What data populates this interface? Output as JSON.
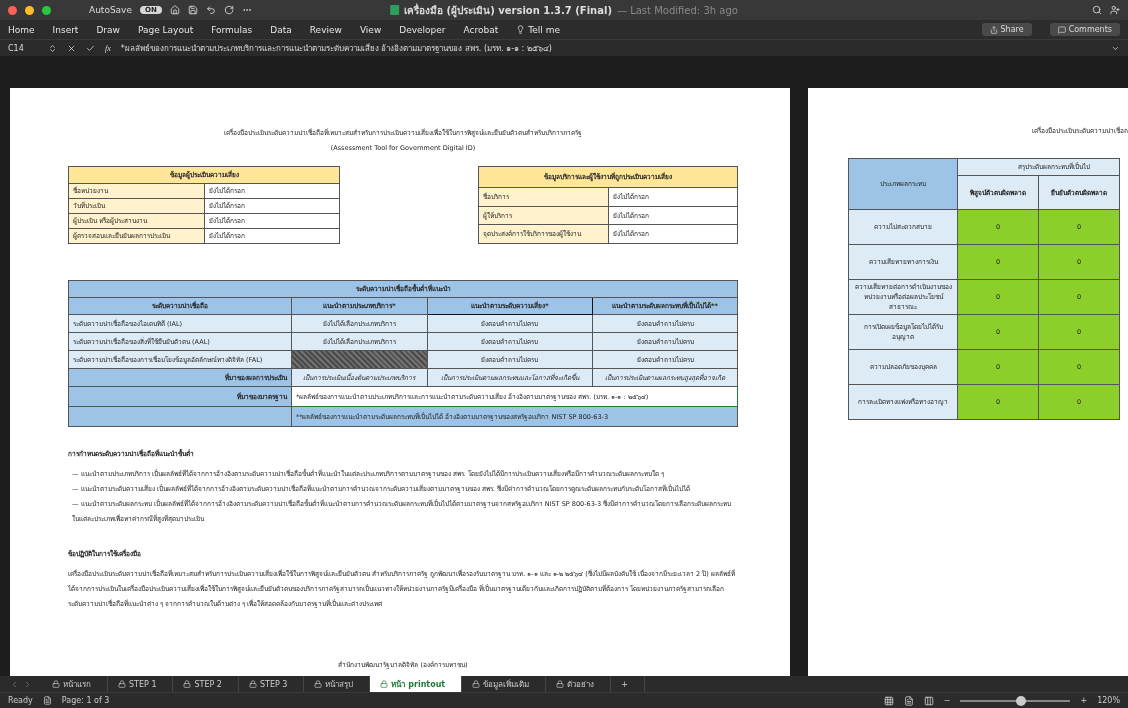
{
  "window": {
    "title": "เครื่องมือ (ผู้ประเมิน) version 1.3.7 (Final)",
    "modified": "— Last Modified: 3h ago",
    "autosave": {
      "label": "AutoSave",
      "state": "ON",
      "on": true
    }
  },
  "ribbon": {
    "tabs": [
      "Home",
      "Insert",
      "Draw",
      "Page Layout",
      "Formulas",
      "Data",
      "Review",
      "View",
      "Developer",
      "Acrobat",
      "Tell me"
    ],
    "share": "Share",
    "comments": "Comments"
  },
  "formula_bar": {
    "cell": "C14",
    "fx": "fx",
    "value": "*ผลลัพธ์ของการแนะนำตามประเภทบริการและการแนะนำตามระดับความเสี่ยง อ้างอิงตามมาตรฐานของ สพร. (มรท. ๑-๑ : ๒๕๖๔)"
  },
  "page": {
    "title": "เครื่องมือประเมินระดับความน่าเชื่อถือที่เหมาะสมสำหรับการประเมินความเสี่ยงเพื่อใช้ในการพิสูจน์และยืนยันตัวตนสำหรับบริการภาครัฐ",
    "subtitle": "(Assessment Tool for Government Digital ID)",
    "info_tables": [
      {
        "heading": "ข้อมูลผู้ประเมินความเสี่ยง",
        "rows": [
          {
            "label": "ชื่อหน่วยงาน",
            "value": "ยังไม่ได้กรอก"
          },
          {
            "label": "วันที่ประเมิน",
            "value": "ยังไม่ได้กรอก"
          },
          {
            "label": "ผู้ประเมิน หรือผู้ประสานงาน",
            "value": "ยังไม่ได้กรอก"
          },
          {
            "label": "ผู้ตรวจสอบและยืนยันผลการประเมิน",
            "value": "ยังไม่ได้กรอก"
          }
        ]
      },
      {
        "heading": "ข้อมูลบริการและผู้ใช้งานที่ถูกประเมินความเสี่ยง",
        "rows": [
          {
            "label": "ชื่อบริการ",
            "value": "ยังไม่ได้กรอก"
          },
          {
            "label": "ผู้ให้บริการ",
            "value": "ยังไม่ได้กรอก"
          },
          {
            "label": "จุดประสงค์การใช้บริการของผู้ใช้งาน",
            "value": "ยังไม่ได้กรอก"
          }
        ]
      }
    ],
    "level_table": {
      "heading": "ระดับความน่าเชื่อถือขั้นต่ำที่แนะนำ",
      "columns": [
        "ระดับความน่าเชื่อถือ",
        "แนะนำตามประเภทบริการ*",
        "แนะนำตามระดับความเสี่ยง*",
        "แนะนำตามระดับผลกระทบที่เป็นไปได้**"
      ],
      "rows": [
        {
          "cells": [
            {
              "kind": "label",
              "text": "ระดับความน่าเชื่อถือของไอเดนทิตี (IAL)"
            },
            {
              "kind": "text",
              "text": "ยังไม่ได้เลือกประเภทบริการ"
            },
            {
              "kind": "text",
              "text": "ยังตอบคำถามไม่ครบ"
            },
            {
              "kind": "text",
              "text": "ยังตอบคำถามไม่ครบ"
            }
          ]
        },
        {
          "cells": [
            {
              "kind": "label",
              "text": "ระดับความน่าเชื่อถือของสิ่งที่ใช้ยืนยันตัวตน (AAL)"
            },
            {
              "kind": "text",
              "text": "ยังไม่ได้เลือกประเภทบริการ"
            },
            {
              "kind": "text",
              "text": "ยังตอบคำถามไม่ครบ"
            },
            {
              "kind": "text",
              "text": "ยังตอบคำถามไม่ครบ"
            }
          ]
        },
        {
          "cells": [
            {
              "kind": "label",
              "text": "ระดับความน่าเชื่อถือของการเชื่อมโยงข้อมูลอัตลักษณ์ทางดิจิทัล (FAL)"
            },
            {
              "kind": "hatched"
            },
            {
              "kind": "text",
              "text": "ยังตอบคำถามไม่ครบ"
            },
            {
              "kind": "text",
              "text": "ยังตอบคำถามไม่ครบ"
            }
          ]
        }
      ],
      "source_label": "ที่มาของผลการประเมิน",
      "sources": [
        "เป็นการประเมินเบื้องต้นตามประเภทบริการ",
        "เป็นการประเมินตามผลกระทบและโอกาสที่จะเกิดขึ้น",
        "เป็นการประเมินตามผลกระทบสูงสุดที่อาจเกิด"
      ],
      "standard_label": "ที่มาของมาตรฐาน",
      "standard_notes": [
        "*ผลลัพธ์ของการแนะนำตามประเภทบริการและการแนะนำตามระดับความเสี่ยง อ้างอิงตามมาตรฐานของ สพร. (มรท. ๑-๑ : ๒๕๖๔)",
        "**ผลลัพธ์ของการแนะนำตามระดับผลกระทบที่เป็นไปได้ อ้างอิงตามมาตรฐานของสหรัฐอเมริกา NIST SP 800-63-3"
      ]
    },
    "sections": [
      {
        "heading": "การกำหนดระดับความน่าเชื่อถือที่แนะนำขั้นต่ำ",
        "bullets": [
          "— แนะนำตามประเภทบริการ เป็นผลลัพธ์ที่ได้จากการอ้างอิงตามระดับความน่าเชื่อถือขั้นต่ำที่แนะนำในแต่ละประเภทบริการตามมาตรฐานของ สพร. โดยยังไม่ได้มีการประเมินความเสี่ยงหรือมีการคำนวณระดับผลกระทบใด ๆ",
          "— แนะนำตามระดับความเสี่ยง เป็นผลลัพธ์ที่ได้จากการอ้างอิงตามระดับความน่าเชื่อถือที่แนะนำตามการคำนวณจากระดับความเสี่ยงตามมาตรฐานของ สพร. ซึ่งมีค่าการคำนวณโดยการคูณระดับผลกระทบกับระดับโอกาสที่เป็นไปได้",
          "— แนะนำตามระดับผลกระทบ เป็นผลลัพธ์ที่ได้จากการอ้างอิงตามระดับความน่าเชื่อถือขั้นต่ำที่แนะนำตามการคำนวณระดับผลกระทบที่เป็นไปได้ตามมาตรฐานจากสหรัฐอเมริกา NIST SP 800-63-3 ซึ่งมีค่าการคำนวณโดยการเลือกระดับผลกระทบในแต่ละประเภทเพื่อหาค่ากรณีที่สูงที่สุดมาประเมิน"
        ]
      },
      {
        "heading": "ข้อปฏิบัติในการใช้เครื่องมือ",
        "paragraph": "เครื่องมือประเมินระดับความน่าเชื่อถือที่เหมาะสมสำหรับการประเมินความเสี่ยงเพื่อใช้ในการพิสูจน์และยืนยันตัวตน สำหรับบริการภาครัฐ ถูกพัฒนาเพื่อรองรับมาตรฐาน มรท. ๑-๑ และ ๑-๒ ๒๕๖๔ (ซึ่งไม่มีผลบังคับใช้ เนื่องจากมีระยะเวลา 2 ปี) ผลลัพธ์ที่ได้จากการประเมินในเครื่องมือประเมินความเสี่ยงเพื่อใช้ในการพิสูจน์และยืนยันตัวตนของบริการภาครัฐสามารถเป็นแนวทางให้หน่วยงานภาครัฐมีเครื่องมือ ที่เป็นมาตรฐานเดียวกันและเกิดการปฏิบัติตามที่ต้องการ โดยหน่วยงานภาครัฐสามารถเลือกระดับความน่าเชื่อถือที่แนะนำต่าง ๆ จากการคำนวณในด้านต่าง ๆ เพื่อให้สอดคล้องกับมาตรฐานที่เป็นและต่างประเทศ"
      }
    ],
    "footer": "สำนักงานพัฒนารัฐบาลดิจิทัล (องค์การมหาชน)"
  },
  "page_2": {
    "title": "เครื่องมือประเมินระดับความน่าเชื่อถ",
    "impact_table": {
      "row_heading": "ประเภทผลกระทบ",
      "group_heading": "สรุประดับผลกระทบที่เป็นไป",
      "columns": [
        "พิสูจน์ตัวตนผิดพลาด",
        "ยืนยันตัวตนผิดพลาด"
      ],
      "rows": [
        {
          "label": "ความไม่สะดวกสบาย",
          "values": [
            "0",
            "0"
          ]
        },
        {
          "label": "ความเสียหายทางการเงิน",
          "values": [
            "0",
            "0"
          ]
        },
        {
          "label": "ความเสียหายต่อการดำเนินงานของหน่วยงานหรือต่อผลประโยชน์สาธารณะ",
          "values": [
            "0",
            "0"
          ]
        },
        {
          "label": "การเปิดเผยข้อมูลโดยไม่ได้รับอนุญาต",
          "values": [
            "0",
            "0"
          ]
        },
        {
          "label": "ความปลอดภัยของบุคคล",
          "values": [
            "0",
            "0"
          ]
        },
        {
          "label": "การละเมิดทางแพ่งหรือทางอาญา",
          "values": [
            "0",
            "0"
          ]
        }
      ]
    }
  },
  "sheet_tabs": [
    {
      "label": "หน้าแรก",
      "selected": false
    },
    {
      "label": "STEP 1",
      "selected": false
    },
    {
      "label": "STEP 2",
      "selected": false
    },
    {
      "label": "STEP 3",
      "selected": false
    },
    {
      "label": "หน้าสรุป",
      "selected": false
    },
    {
      "label": "หน้า printout",
      "selected": true
    },
    {
      "label": "ข้อมูลเพิ่มเติม",
      "selected": false
    },
    {
      "label": "ตัวอย่าง",
      "selected": false
    }
  ],
  "add_sheet": "+",
  "status_bar": {
    "state": "Ready",
    "page": "Page: 1 of 3",
    "zoom_out": "−",
    "level": 0.55,
    "zoom_in": "+",
    "zoom": "120%"
  }
}
